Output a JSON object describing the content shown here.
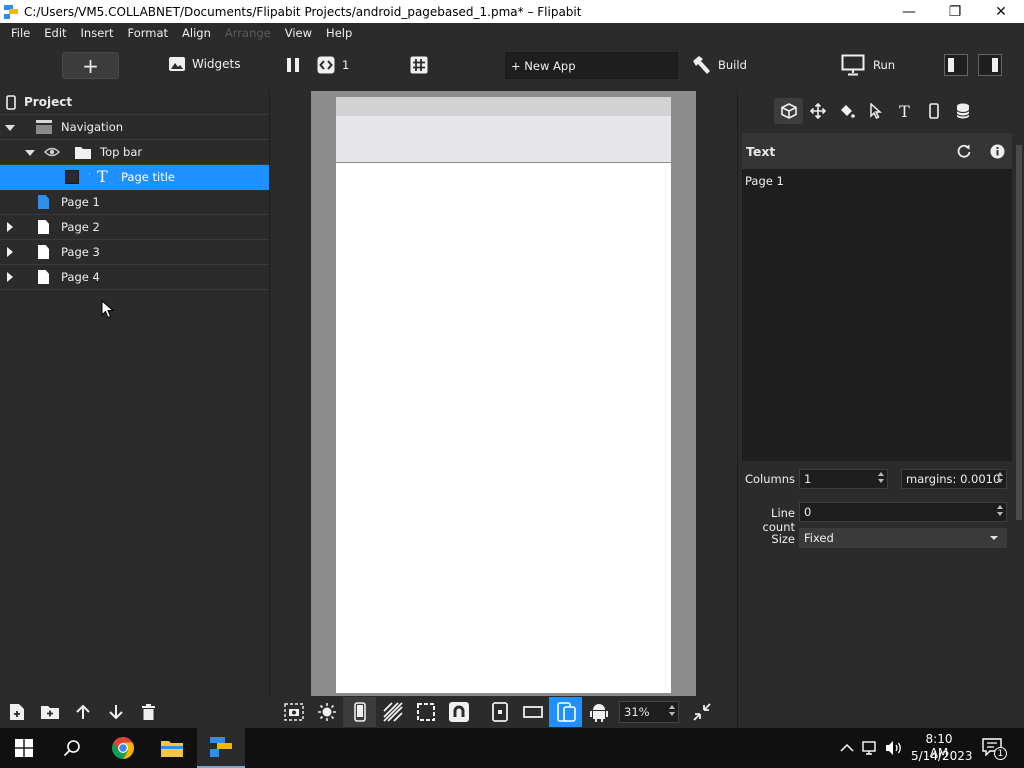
{
  "window": {
    "title": "C:/Users/VM5.COLLABNET/Documents/Flipabit Projects/android_pagebased_1.pma* – Flipabit",
    "minimize_glyph": "—",
    "maximize_glyph": "❐",
    "close_glyph": "✕"
  },
  "menu": [
    "File",
    "Edit",
    "Insert",
    "Format",
    "Align",
    "Arrange",
    "View",
    "Help"
  ],
  "toolbar": {
    "add_glyph": "+",
    "widgets_label": "Widgets",
    "page_counter": "1",
    "new_app_label": "+ New App",
    "build_label": "Build",
    "run_label": "Run"
  },
  "project": {
    "header": "Project",
    "tree": [
      {
        "label": "Navigation"
      },
      {
        "label": "Top bar"
      },
      {
        "label": "Page title"
      },
      {
        "label": "Page 1"
      },
      {
        "label": "Page 2"
      },
      {
        "label": "Page 3"
      },
      {
        "label": "Page 4"
      }
    ]
  },
  "inspector": {
    "section_title": "Text",
    "text_value": "Page 1",
    "columns_label": "Columns",
    "columns_value": "1",
    "margins_value": "margins: 0.0010",
    "line_count_label": "Line count",
    "line_count_value": "0",
    "size_label": "Size",
    "size_value": "Fixed"
  },
  "canvas": {
    "zoom": "31%"
  },
  "taskbar": {
    "time": "8:10 AM",
    "date": "5/14/2023",
    "notification_count": "1"
  },
  "colors": {
    "accent": "#1e90ff",
    "panel": "#2b2b2b",
    "field": "#1e1e1e"
  }
}
